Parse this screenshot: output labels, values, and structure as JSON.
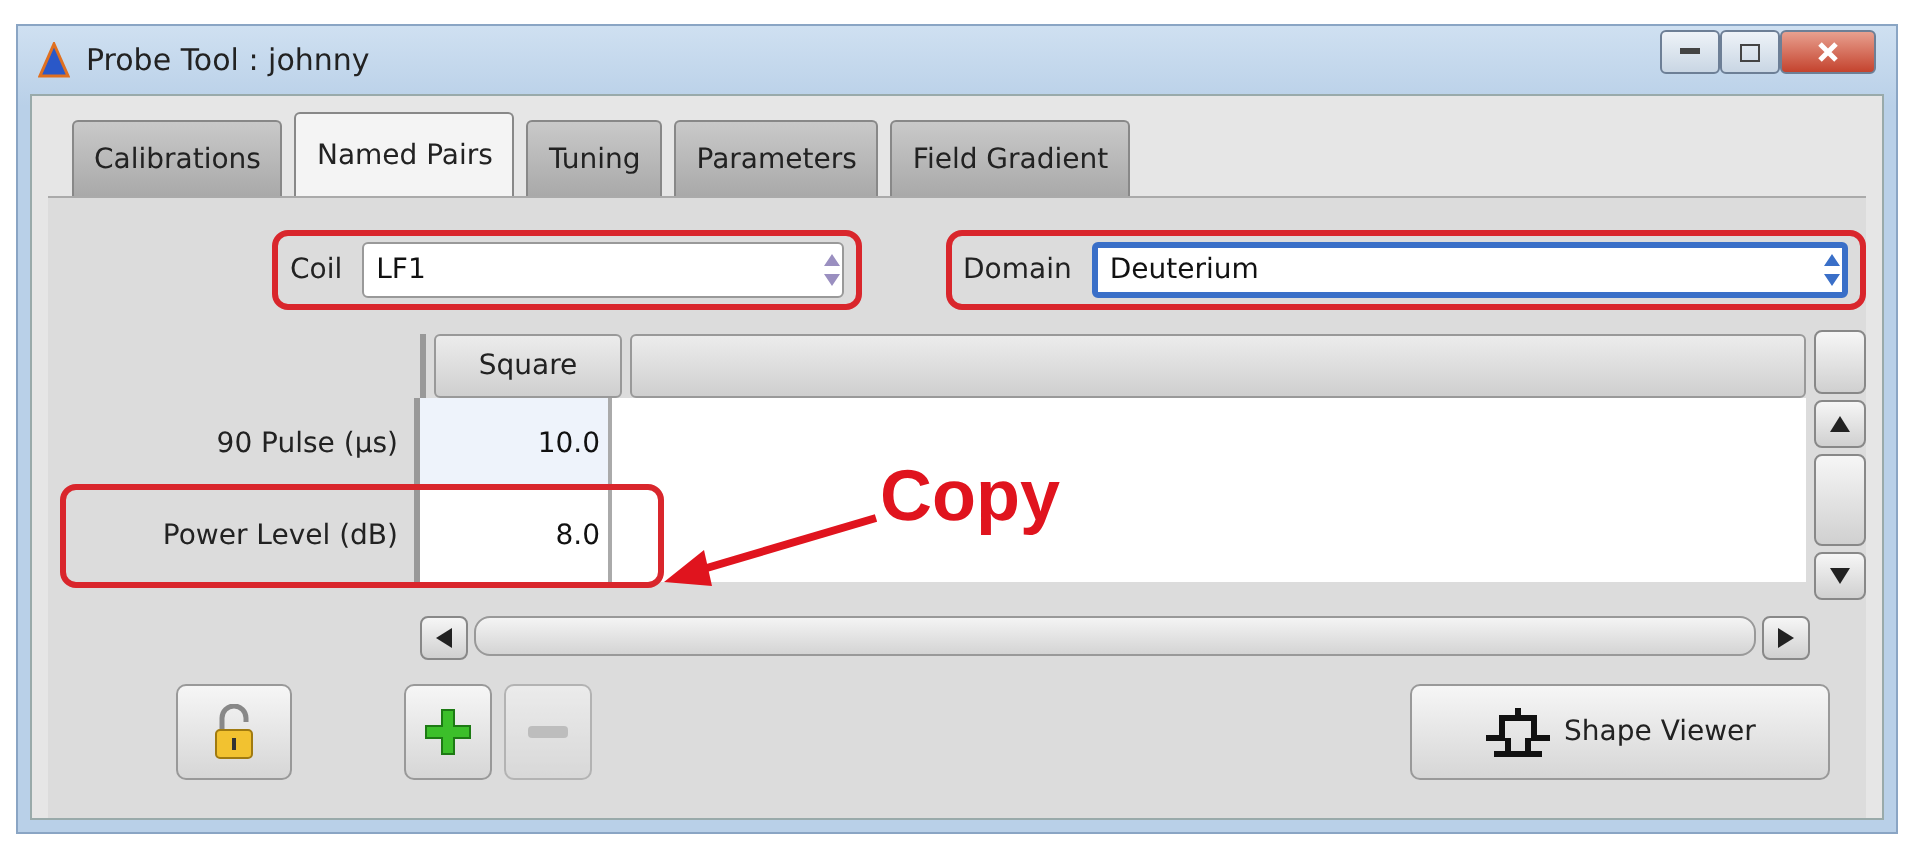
{
  "window": {
    "title": "Probe Tool : johnny"
  },
  "tabs": [
    {
      "label": "Calibrations",
      "selected": false
    },
    {
      "label": "Named Pairs",
      "selected": true
    },
    {
      "label": "Tuning",
      "selected": false
    },
    {
      "label": "Parameters",
      "selected": false
    },
    {
      "label": "Field Gradient",
      "selected": false
    }
  ],
  "fields": [
    {
      "label": "Coil",
      "value": "LF1",
      "focused": false,
      "highlighted": true
    },
    {
      "label": "Domain",
      "value": "Deuterium",
      "focused": true,
      "highlighted": true
    }
  ],
  "table": {
    "columns": [
      "Square"
    ],
    "rows": [
      {
        "label": "90 Pulse (µs)",
        "values": [
          "10.0"
        ],
        "highlighted": false
      },
      {
        "label": "Power Level (dB)",
        "values": [
          "8.0"
        ],
        "highlighted": true
      }
    ]
  },
  "callout": {
    "text": "Copy"
  },
  "buttons": [
    {
      "kind": "lock",
      "disabled": false
    },
    {
      "kind": "add",
      "disabled": false
    },
    {
      "kind": "remove",
      "disabled": true
    },
    {
      "kind": "shape_viewer",
      "label": "Shape Viewer",
      "disabled": false
    }
  ]
}
